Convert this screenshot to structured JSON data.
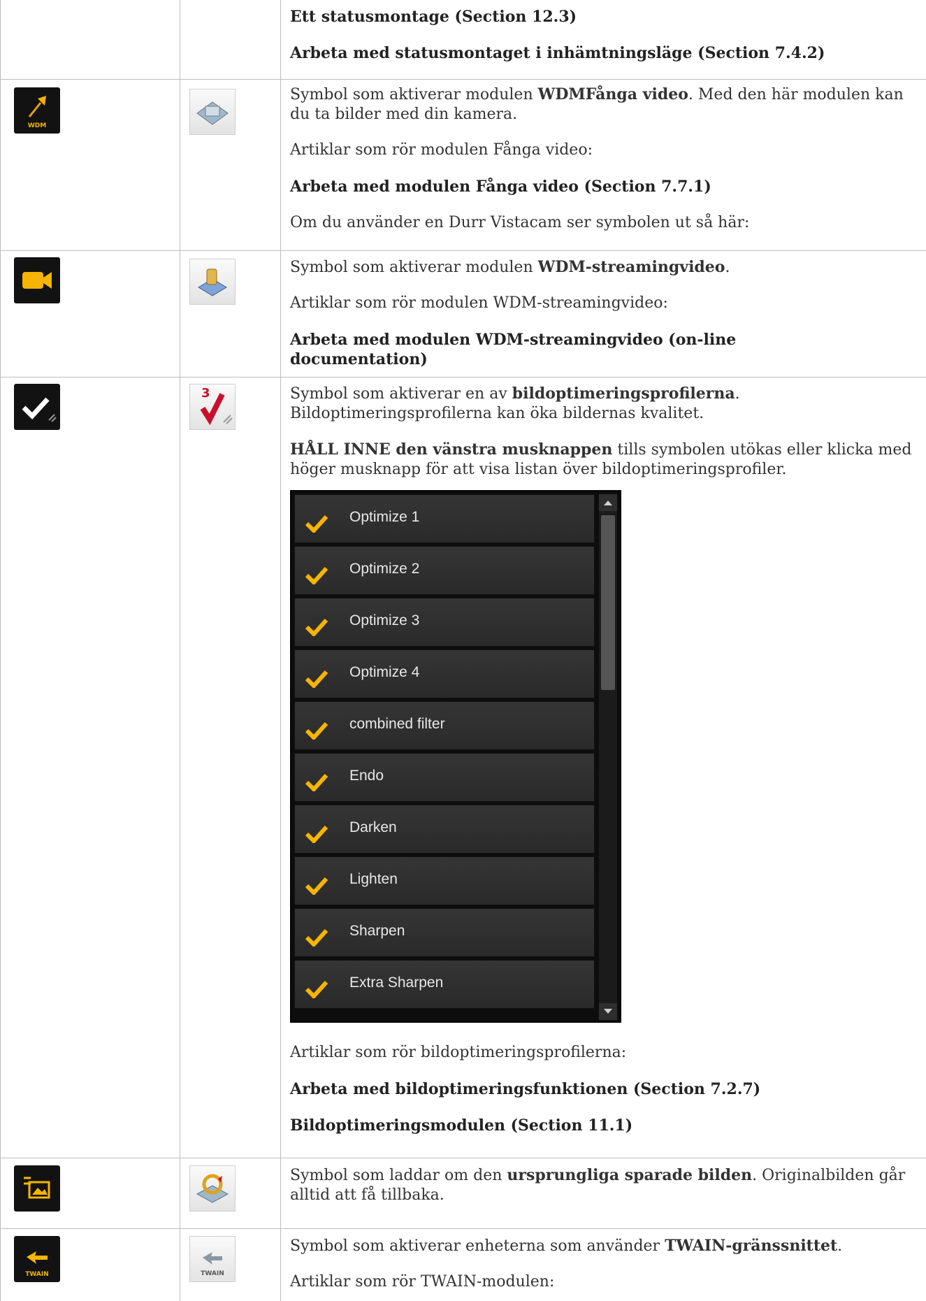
{
  "row1": {
    "link1": "Ett statusmontage (Section 12.3)",
    "link2": "Arbeta med statusmontaget i inhämtningsläge (Section 7.4.2)"
  },
  "row2": {
    "dark_icon_label": "WDM",
    "p1_pre": "Symbol som aktiverar modulen ",
    "p1_bold": "WDMFånga video",
    "p1_post": ". Med den här modulen kan du ta bilder med din kamera.",
    "p2": "Artiklar som rör modulen Fånga video:",
    "link": "Arbeta med modulen Fånga video (Section 7.7.1)",
    "p3": "Om du använder en Durr Vistacam ser symbolen ut så här:"
  },
  "row3": {
    "p1_pre": "Symbol som aktiverar modulen ",
    "p1_bold": "WDM-streamingvideo",
    "p1_post": ".",
    "p2": "Artiklar som rör modulen WDM-streamingvideo:",
    "link": "Arbeta med modulen WDM-streamingvideo (on-line documentation)"
  },
  "row4": {
    "light_icon_number": "3",
    "p1_pre": "Symbol som aktiverar en av ",
    "p1_bold": "bildoptimeringsprofilerna",
    "p1_post": ". Bildoptimeringsprofilerna kan öka bildernas kvalitet.",
    "p2_bold": "HÅLL INNE den vänstra musknappen",
    "p2_post": " tills symbolen utökas eller klicka med höger musknapp för att visa listan över bildoptimeringsprofiler.",
    "profiles": [
      "Optimize 1",
      "Optimize 2",
      "Optimize 3",
      "Optimize 4",
      "combined filter",
      "Endo",
      "Darken",
      "Lighten",
      "Sharpen",
      "Extra Sharpen"
    ],
    "p3": "Artiklar som rör bildoptimeringsprofilerna:",
    "link1": "Arbeta med bildoptimeringsfunktionen (Section 7.2.7)",
    "link2": "Bildoptimeringsmodulen (Section 11.1)"
  },
  "row5": {
    "p1_pre": "Symbol som laddar om den ",
    "p1_bold": "ursprungliga sparade bilden",
    "p1_post": ". Originalbilden går alltid att få tillbaka."
  },
  "row6": {
    "dark_icon_label": "TWAIN",
    "light_icon_label": "TWAIN",
    "p1_pre": "Symbol som aktiverar enheterna som använder ",
    "p1_bold": "TWAIN-gränssnittet",
    "p1_post": ".",
    "p2": "Artiklar som rör TWAIN-modulen:"
  },
  "colors": {
    "accent_check": "#f7b500",
    "video_icon": "#f5b400"
  }
}
